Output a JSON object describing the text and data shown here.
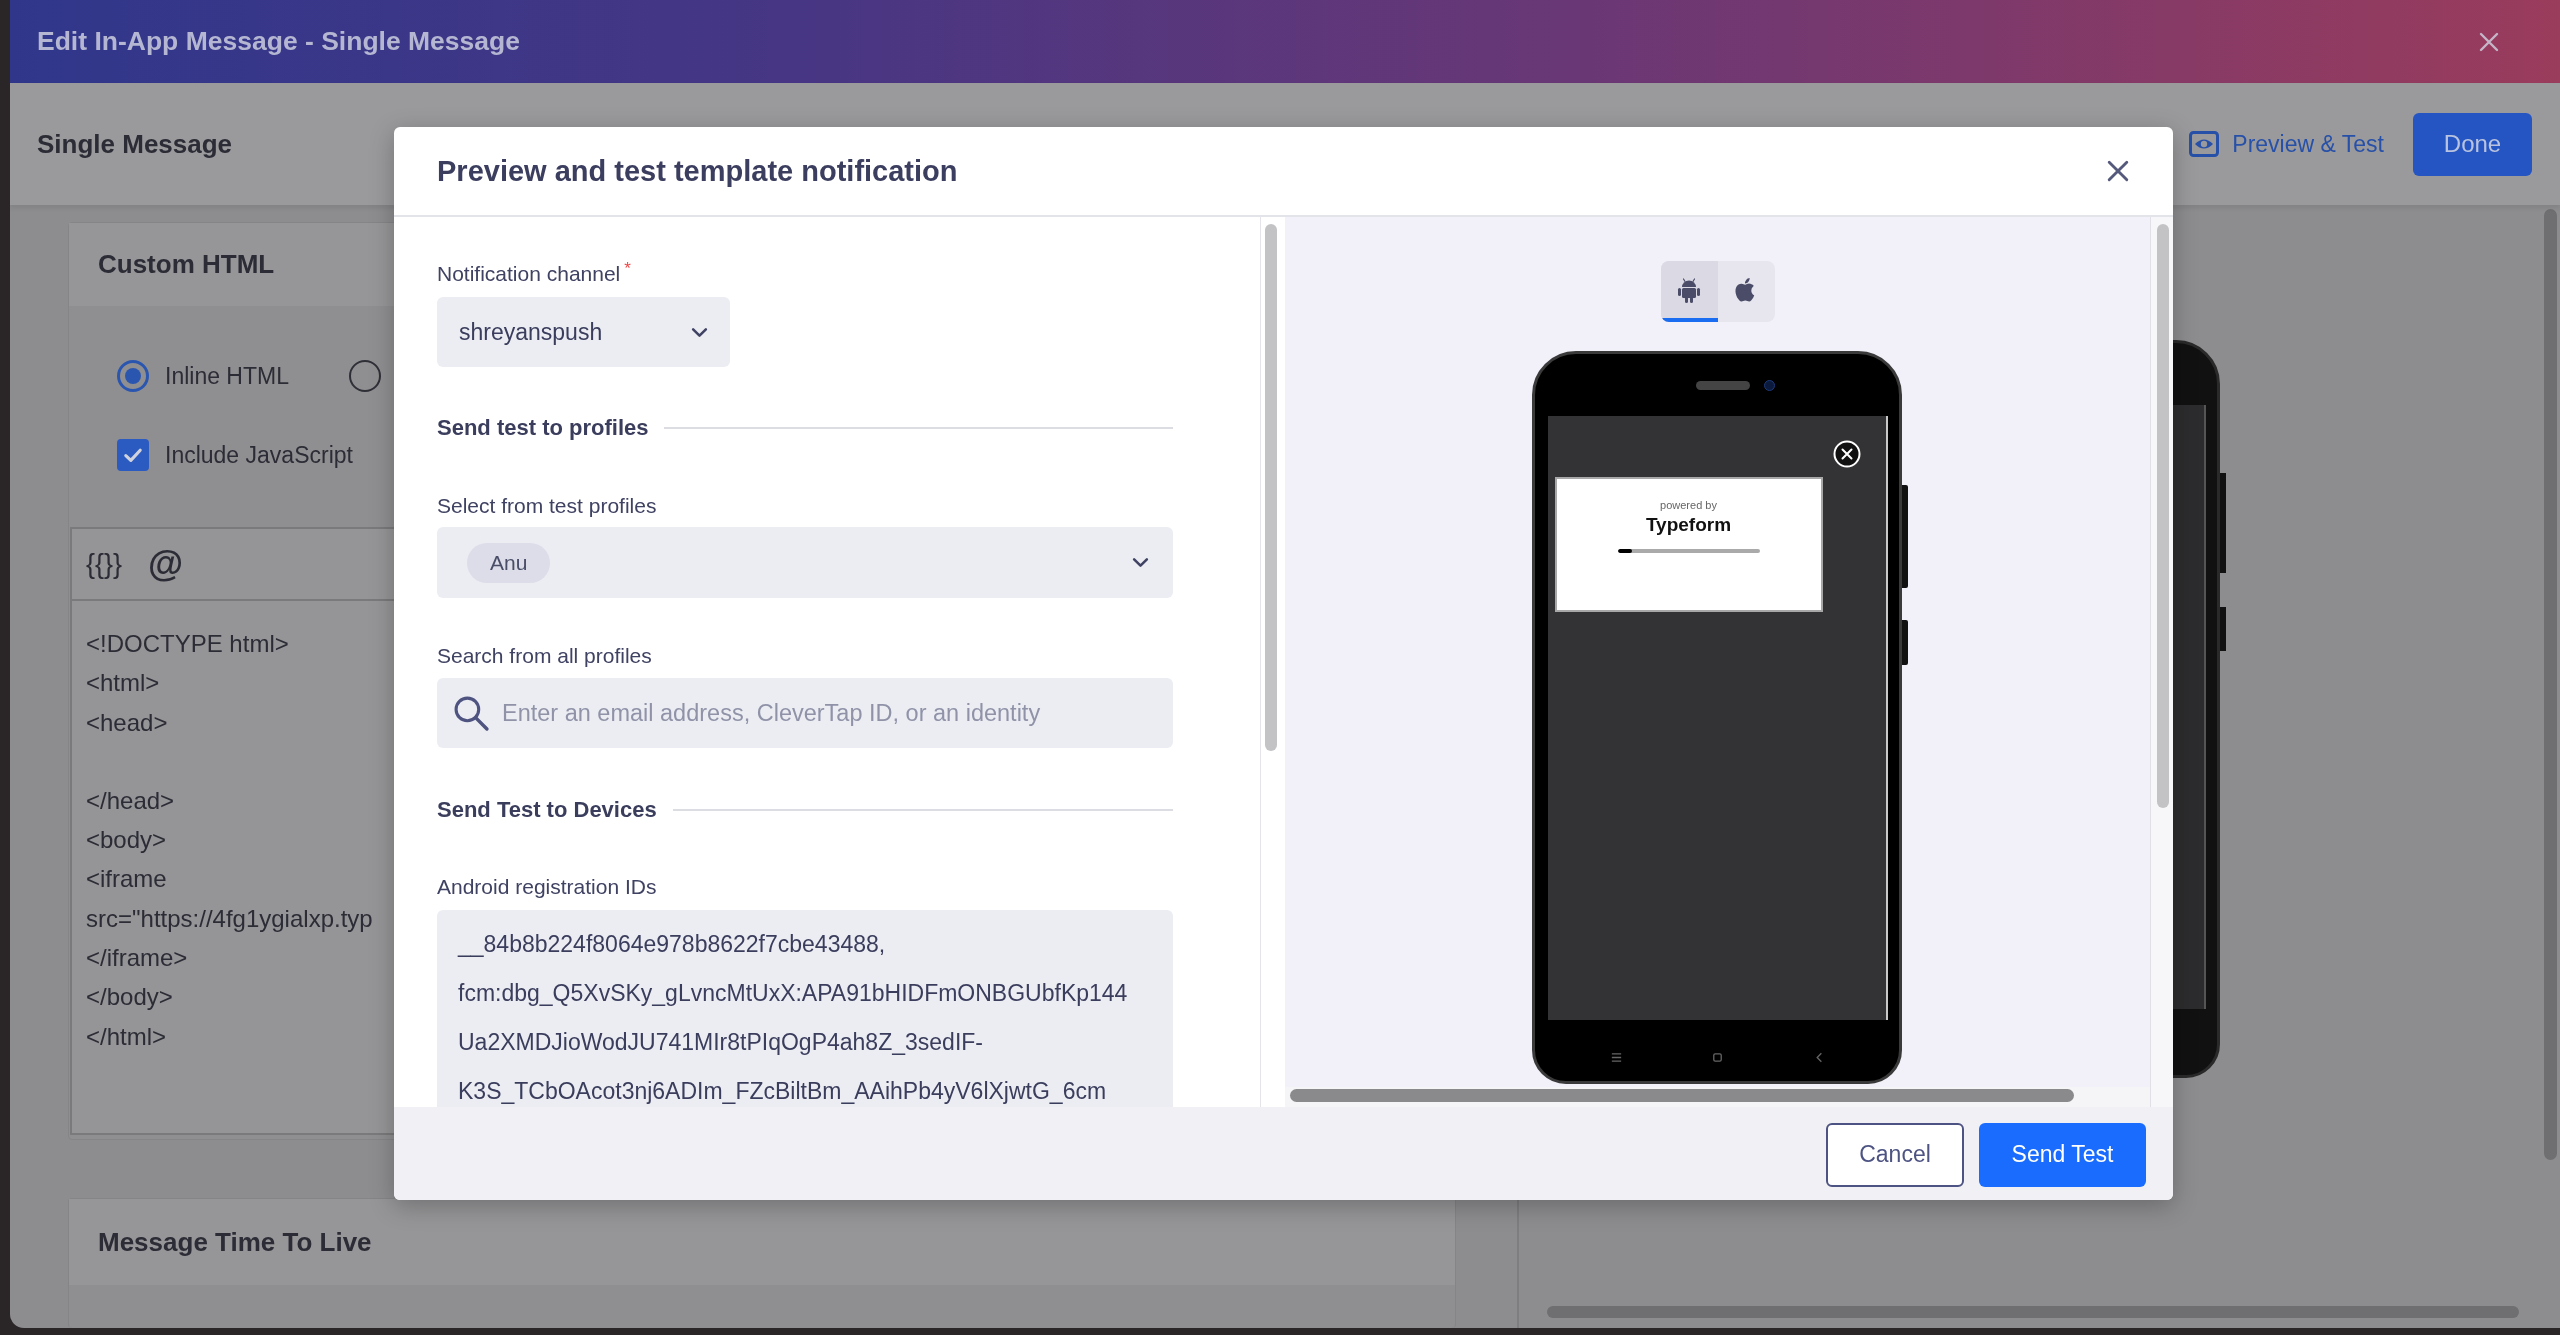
{
  "window": {
    "title": "Edit In-App Message - Single Message"
  },
  "page_header": {
    "title": "Single Message",
    "preview_link": "Preview & Test",
    "done_button": "Done"
  },
  "custom_html": {
    "title": "Custom HTML",
    "options": [
      {
        "label": "Inline HTML",
        "selected": true
      },
      {
        "selected": false
      }
    ],
    "include_javascript": {
      "label": "Include JavaScript",
      "checked": true
    },
    "editor": {
      "toolbar": [
        {
          "kind": "braces",
          "label": "{{}}"
        },
        {
          "kind": "mention",
          "label": "@"
        }
      ],
      "code_blocks": [
        [
          "<!DOCTYPE html>",
          "<html>",
          "<head>"
        ],
        [
          "</head>",
          "<body>",
          "<iframe",
          "src=\"https://4fg1ygialxp.typ",
          "</iframe>",
          "</body>",
          "</html>"
        ]
      ]
    }
  },
  "message_ttl": {
    "title": "Message Time To Live"
  },
  "modal": {
    "title": "Preview and test template notification",
    "notification_channel": {
      "label": "Notification channel",
      "required_mark": "*",
      "value": "shreyanspush"
    },
    "send_to_profiles": {
      "heading": "Send test to profiles",
      "test_profiles": {
        "label": "Select from test profiles",
        "chips": [
          "Anu"
        ]
      },
      "search": {
        "label": "Search from all profiles",
        "placeholder": "Enter an email address, CleverTap ID, or an identity"
      }
    },
    "send_to_devices": {
      "heading": "Send Test to Devices",
      "android_ids": {
        "label": "Android registration IDs",
        "lines": [
          "__84b8b224f8064e978b8622f7cbe43488,",
          "fcm:dbg_Q5XvSKy_gLvncMtUxX:APA91bHIDFmONBGUbfKp144",
          "Ua2XMDJioWodJU741MIr8tPIqOgP4ah8Z_3sedIF-",
          "K3S_TCbOAcot3nj6ADIm_FZcBiltBm_AAihPb4yV6lXjwtG_6cm"
        ]
      }
    },
    "preview": {
      "platforms": [
        {
          "kind": "android",
          "selected": true
        },
        {
          "kind": "ios",
          "selected": false
        }
      ],
      "popup": {
        "caption": "powered by",
        "brand": "Typeform",
        "level": 0.1
      }
    },
    "buttons": [
      {
        "kind": "secondary",
        "label": "Cancel"
      },
      {
        "kind": "primary",
        "label": "Send Test"
      }
    ]
  }
}
